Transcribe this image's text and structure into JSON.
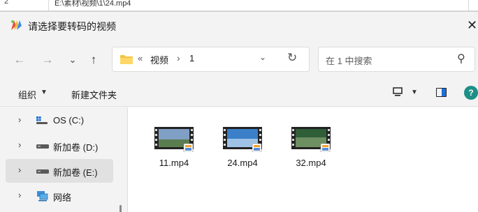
{
  "background": {
    "row_number": "2",
    "cell_text": "E:\\素材\\视频\\1\\24.mp4"
  },
  "dialog": {
    "title": "请选择要转码的视频",
    "close_label": "✕"
  },
  "nav": {
    "back": "←",
    "forward": "→",
    "recent": "⌄",
    "up": "↑"
  },
  "address": {
    "overflow": "«",
    "crumbs": [
      "视频",
      "1"
    ],
    "separator": "›"
  },
  "search": {
    "placeholder": "在 1 中搜索"
  },
  "toolbar": {
    "organize_label": "组织",
    "new_folder_label": "新建文件夹"
  },
  "sidebar": {
    "items": [
      {
        "label": "OS (C:)",
        "icon": "windows-drive-icon",
        "selected": false
      },
      {
        "label": "新加卷 (D:)",
        "icon": "drive-icon",
        "selected": false
      },
      {
        "label": "新加卷 (E:)",
        "icon": "drive-icon",
        "selected": true
      },
      {
        "label": "网络",
        "icon": "network-icon",
        "selected": false
      }
    ]
  },
  "files": [
    {
      "name": "11.mp4",
      "thumb_colors": [
        "#7f9fc4",
        "#5a7d4f"
      ]
    },
    {
      "name": "24.mp4",
      "thumb_colors": [
        "#3b7fc8",
        "#9fc3e6"
      ]
    },
    {
      "name": "32.mp4",
      "thumb_colors": [
        "#2f5e38",
        "#6d8f62"
      ]
    }
  ],
  "colors": {
    "accent": "#1e6fd9",
    "help": "#1d8f86",
    "folder": "#f6c343"
  }
}
